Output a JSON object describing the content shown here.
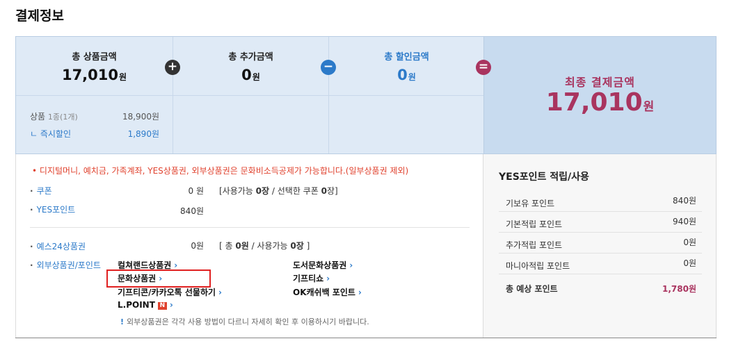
{
  "page_title": "결제정보",
  "summary": {
    "product_total": {
      "label": "총 상품금액",
      "value": "17,010",
      "unit": "원"
    },
    "additional": {
      "label": "총 추가금액",
      "value": "0",
      "unit": "원"
    },
    "discount": {
      "label": "총 할인금액",
      "value": "0",
      "unit": "원"
    },
    "operators": {
      "plus": "+",
      "minus": "−",
      "equal": "="
    },
    "details": [
      {
        "label": "상품",
        "sub": "1종(1개)",
        "value": "18,900원"
      },
      {
        "label": "ㄴ 즉시할인",
        "value": "1,890원"
      }
    ],
    "final": {
      "label": "최종 결제금액",
      "value": "17,010",
      "unit": "원"
    }
  },
  "payment": {
    "notice": "디지털머니, 예치금, 가족계좌, YES상품권, 외부상품권은 문화비소득공제가 가능합니다.(일부상품권 제외)",
    "coupon": {
      "label": "쿠폰",
      "amount": "0 원",
      "info_pre": "[사용가능 ",
      "info_b1": "0장",
      "info_mid": " / 선택한 쿠폰 ",
      "info_b2": "0",
      "info_post": "장]"
    },
    "yes_point": {
      "label": "YES포인트",
      "amount": "840원"
    },
    "yes24_giftcard": {
      "label": "예스24상품권",
      "amount": "0원",
      "info_pre": "[ 총 ",
      "info_b1": "0원",
      "info_mid": " / 사용가능 ",
      "info_b2": "0장",
      "info_post": " ]"
    },
    "external": {
      "label": "외부상품권/포인트",
      "items": {
        "culture_land": "컬쳐랜드상품권",
        "munhwa": "문화상품권",
        "gifticon": "기프티콘/카카오톡 선물하기",
        "lpoint": "L.POINT",
        "book_culture": "도서문화상품권",
        "giftishow": "기프티쇼",
        "ok_cashbag": "OK캐쉬백 포인트"
      },
      "chevron": "›",
      "npoint_badge": "N",
      "warning_mark": "!",
      "warning": "외부상품권은 각각 사용 방법이 다르니 자세히 확인 후 이용하시기 바랍니다."
    }
  },
  "points": {
    "title": "YES포인트 적립/사용",
    "rows": [
      {
        "label": "기보유 포인트",
        "value": "840원"
      },
      {
        "label": "기본적립 포인트",
        "value": "940원"
      },
      {
        "label": "추가적립 포인트",
        "value": "0원"
      },
      {
        "label": "마니아적립 포인트",
        "value": "0원"
      }
    ],
    "total": {
      "label": "총 예상 포인트",
      "value": "1,780원"
    }
  },
  "colors": {
    "accent_blue": "#2c7ac9",
    "final_magenta": "#a9345f",
    "notice_red": "#e0422e",
    "summary_bg": "#dfeaf6"
  }
}
